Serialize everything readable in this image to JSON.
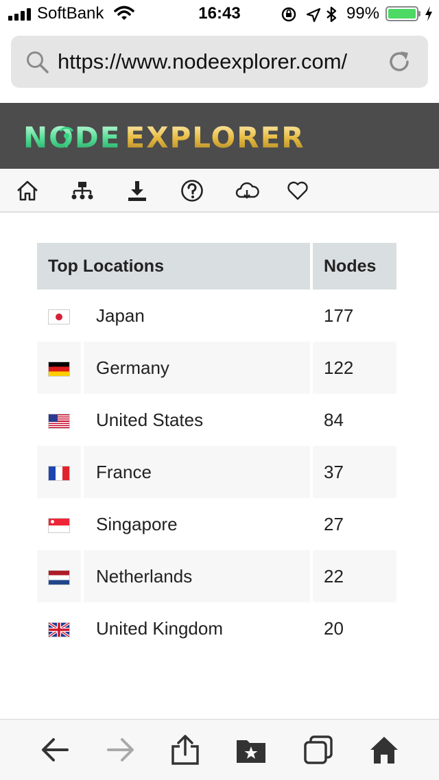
{
  "status_bar": {
    "carrier": "SoftBank",
    "time": "16:43",
    "battery_percent": "99%",
    "battery_level": 0.99,
    "icons": [
      "signal-icon",
      "wifi-icon",
      "orientation-lock-icon",
      "location-icon",
      "bluetooth-icon",
      "battery-icon",
      "charging-icon"
    ]
  },
  "browser": {
    "url": "https://www.nodeexplorer.com/",
    "icons": [
      "search-icon",
      "reload-icon"
    ]
  },
  "header": {
    "logo_text": "NODE EXPLORER",
    "colors": {
      "banner": "#4c4c4c",
      "logo_node": "#3fd38a",
      "logo_explorer": "#e2b93b"
    }
  },
  "nav": {
    "icons": [
      "home-icon",
      "network-icon",
      "download-icon",
      "help-icon",
      "cloud-icon",
      "heart-icon"
    ]
  },
  "table": {
    "headers": {
      "location": "Top Locations",
      "nodes": "Nodes"
    },
    "rows": [
      {
        "flag": "japan-flag-icon",
        "country": "Japan",
        "nodes": "177"
      },
      {
        "flag": "germany-flag-icon",
        "country": "Germany",
        "nodes": "122"
      },
      {
        "flag": "usa-flag-icon",
        "country": "United States",
        "nodes": "84"
      },
      {
        "flag": "france-flag-icon",
        "country": "France",
        "nodes": "37"
      },
      {
        "flag": "singapore-flag-icon",
        "country": "Singapore",
        "nodes": "27"
      },
      {
        "flag": "netherlands-flag-icon",
        "country": "Netherlands",
        "nodes": "22"
      },
      {
        "flag": "uk-flag-icon",
        "country": "United Kingdom",
        "nodes": "20"
      }
    ]
  },
  "toolbar": {
    "icons": [
      "back-icon",
      "forward-icon",
      "share-icon",
      "bookmarks-icon",
      "tabs-icon",
      "home-icon"
    ]
  }
}
